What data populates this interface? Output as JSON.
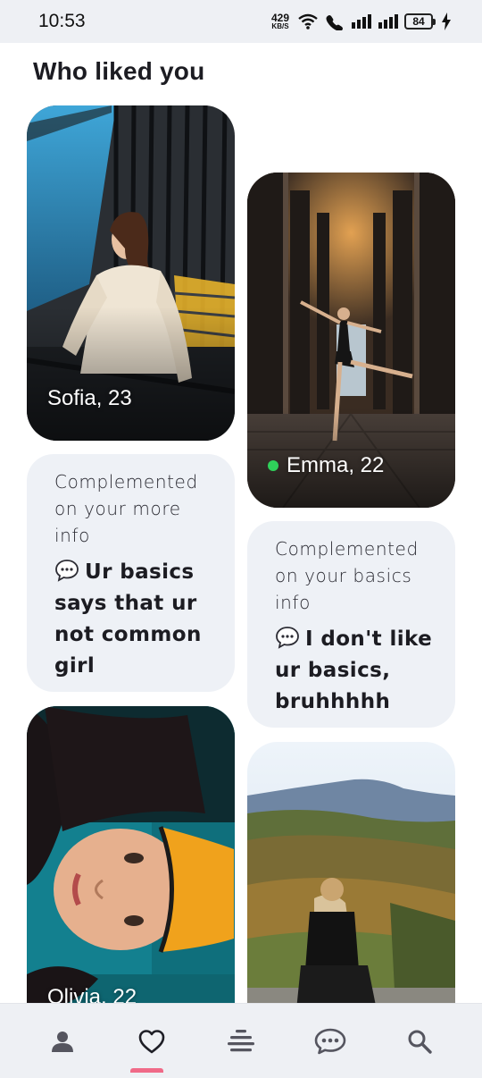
{
  "status_bar": {
    "time": "10:53",
    "net_speed_value": "429",
    "net_speed_unit": "KB/S",
    "battery": "84"
  },
  "page": {
    "title": "Who liked you"
  },
  "cards": [
    {
      "name": "Sofia, 23",
      "online": false
    },
    {
      "name": "Emma, 22",
      "online": true
    },
    {
      "name": "Olivia, 22",
      "online": false
    },
    {
      "name": "",
      "online": false
    }
  ],
  "notes": [
    {
      "label": "Complemented on your more info",
      "message": "Ur basics says that ur not common girl"
    },
    {
      "label": "Complemented on your basics info",
      "message": "I don't like ur basics, bruhhhhh"
    }
  ],
  "nav": {
    "items": [
      {
        "icon": "person-icon"
      },
      {
        "icon": "heart-icon",
        "active": true
      },
      {
        "icon": "feed-icon"
      },
      {
        "icon": "chat-icon"
      },
      {
        "icon": "search-icon"
      }
    ],
    "active_color": "#f06a88"
  }
}
